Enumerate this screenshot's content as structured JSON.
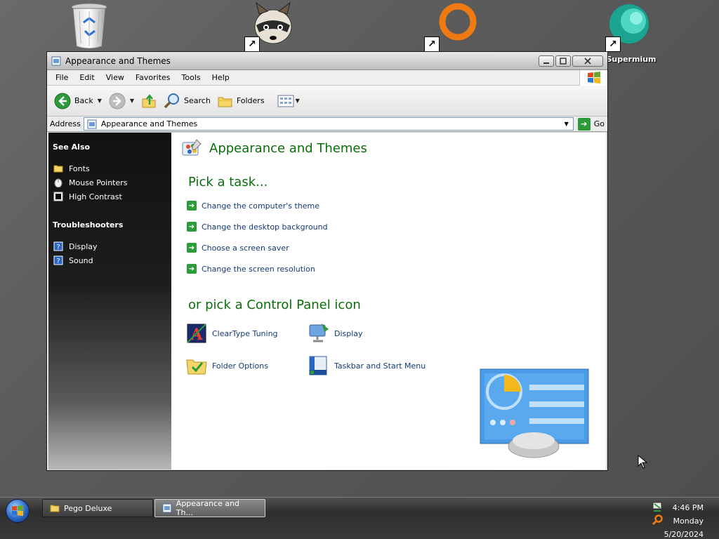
{
  "desktop": {
    "icons": [
      {
        "name": "Recycle Bin",
        "label": ""
      },
      {
        "name": "Raccoon",
        "label": ""
      },
      {
        "name": "Orange Ring",
        "label": ""
      },
      {
        "name": "Supermium",
        "label": "Supermium"
      }
    ]
  },
  "window": {
    "title": "Appearance and Themes",
    "menu": [
      "File",
      "Edit",
      "View",
      "Favorites",
      "Tools",
      "Help"
    ],
    "toolbar": {
      "back_label": "Back",
      "search_label": "Search",
      "folders_label": "Folders"
    },
    "address": {
      "label": "Address",
      "value": "Appearance and Themes",
      "go_label": "Go"
    },
    "sidebar": {
      "see_also_title": "See Also",
      "see_also": [
        "Fonts",
        "Mouse Pointers",
        "High Contrast"
      ],
      "troubleshooters_title": "Troubleshooters",
      "troubleshooters": [
        "Display",
        "Sound"
      ]
    },
    "main": {
      "category_title": "Appearance and Themes",
      "pick_task_title": "Pick a task...",
      "tasks": [
        "Change the computer's theme",
        "Change the desktop background",
        "Choose a screen saver",
        "Change the screen resolution"
      ],
      "pick_icon_title": "or pick a Control Panel icon",
      "icons": [
        "ClearType Tuning",
        "Display",
        "Folder Options",
        "Taskbar and Start Menu"
      ]
    }
  },
  "taskbar": {
    "buttons": [
      "Pego Deluxe",
      "Appearance and Th..."
    ],
    "active_index": 1,
    "clock": {
      "time": "4:46 PM",
      "day": "Monday",
      "date": "5/20/2024"
    }
  },
  "colors": {
    "accent_green": "#0a6e0a",
    "link_blue": "#123a75",
    "sidebar_dark": "#111111"
  }
}
